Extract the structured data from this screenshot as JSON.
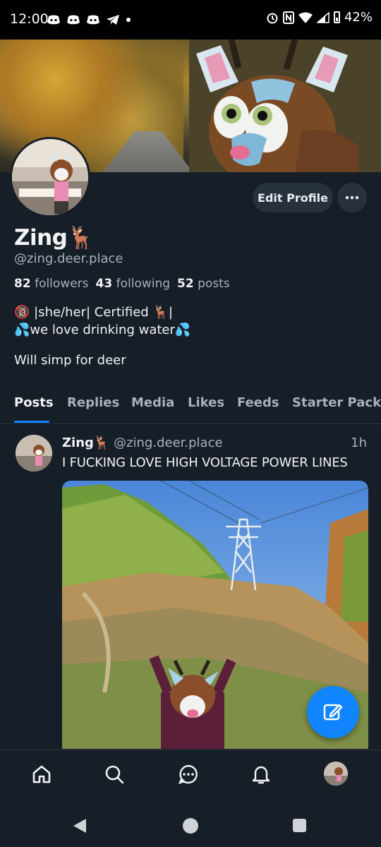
{
  "status_bar": {
    "time": "12:00",
    "battery": "42%",
    "notification_icons": [
      "discord-icon",
      "discord-icon",
      "discord-icon",
      "telegram-icon",
      "dot-icon"
    ],
    "system_icons": [
      "alarm-icon",
      "nfc-icon",
      "wifi-icon",
      "signal-icon",
      "battery-icon"
    ]
  },
  "profile": {
    "name": "Zing🦌",
    "handle": "@zing.deer.place",
    "edit_label": "Edit Profile",
    "stats": {
      "followers_count": "82",
      "followers_label": "followers",
      "following_count": "43",
      "following_label": "following",
      "posts_count": "52",
      "posts_label": "posts"
    },
    "bio_line1": "🔞 |she/her| Certified 🦌|",
    "bio_line2": " 💦we love drinking water💦",
    "bio_line3": "Will simp for deer"
  },
  "tabs": [
    "Posts",
    "Replies",
    "Media",
    "Likes",
    "Feeds",
    "Starter Packs"
  ],
  "active_tab": "Posts",
  "post": {
    "author_name": "Zing🦌",
    "author_handle": "@zing.deer.place",
    "time": "1h",
    "text": "I FUCKING LOVE HIGH VOLTAGE POWER LINES"
  },
  "colors": {
    "background": "#161e27",
    "accent": "#1185fe",
    "muted_text": "#a7b2bf",
    "button_bg": "#26313d"
  },
  "nav_icons": [
    "home-icon",
    "search-icon",
    "chat-icon",
    "bell-icon",
    "profile-avatar"
  ]
}
